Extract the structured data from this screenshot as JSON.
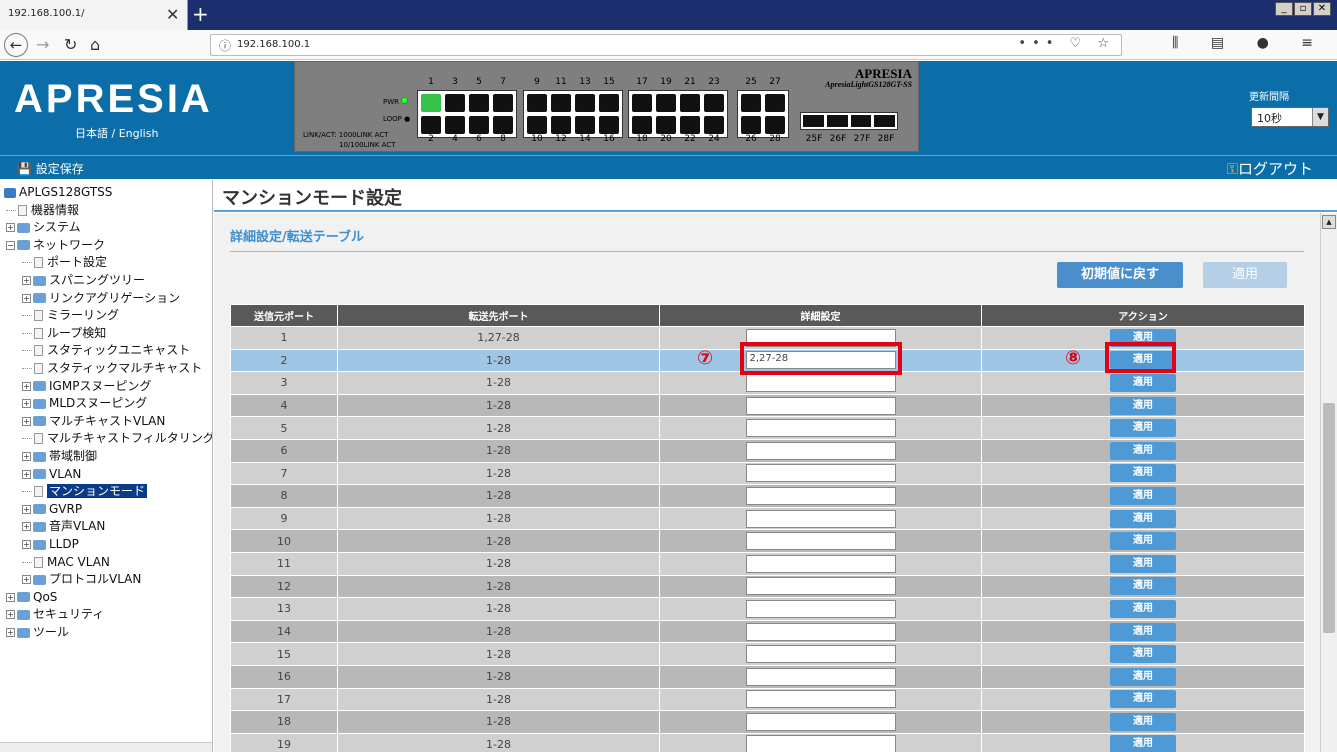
{
  "browser": {
    "tab_title": "192.168.100.1/",
    "tab_close": "✕",
    "new_tab": "+",
    "url": "192.168.100.1",
    "url_actions": "••• ♡ ☆",
    "win_controls": [
      "_",
      "▫",
      "✕"
    ],
    "menu_icons": "⫼ ▤ ● ≡"
  },
  "header": {
    "logo": "APRESIA",
    "language": "日本語 / English",
    "refresh_label": "更新間隔",
    "refresh_value": "10秒",
    "save_label": "設定保存",
    "logout_label": "ログアウト"
  },
  "switch_panel": {
    "brand": "APRESIA",
    "model": "ApresiaLightGS128GT-SS",
    "pwr": "PWR",
    "loop": "LOOP",
    "legend1": "LINK/ACT: 1000LINK   ACT",
    "legend2": "10/100LINK   ACT",
    "top_nums": [
      "1",
      "3",
      "5",
      "7",
      "9",
      "11",
      "13",
      "15",
      "17",
      "19",
      "21",
      "23",
      "25",
      "27"
    ],
    "bottom_nums": [
      "2",
      "4",
      "6",
      "8",
      "10",
      "12",
      "14",
      "16",
      "18",
      "20",
      "22",
      "24",
      "26",
      "28"
    ],
    "sfp_nums": [
      "25F",
      "26F",
      "27F",
      "28F"
    ]
  },
  "sidebar": {
    "items": [
      {
        "label": "APLGS128GTSS",
        "level": 0,
        "type": "root"
      },
      {
        "label": "機器情報",
        "level": 1,
        "type": "page"
      },
      {
        "label": "システム",
        "level": 1,
        "type": "folder"
      },
      {
        "label": "ネットワーク",
        "level": 1,
        "type": "folder-open"
      },
      {
        "label": "ポート設定",
        "level": 2,
        "type": "page"
      },
      {
        "label": "スパニングツリー",
        "level": 2,
        "type": "folder"
      },
      {
        "label": "リンクアグリゲーション",
        "level": 2,
        "type": "folder"
      },
      {
        "label": "ミラーリング",
        "level": 2,
        "type": "page"
      },
      {
        "label": "ループ検知",
        "level": 2,
        "type": "page"
      },
      {
        "label": "スタティックユニキャスト",
        "level": 2,
        "type": "page"
      },
      {
        "label": "スタティックマルチキャスト",
        "level": 2,
        "type": "page"
      },
      {
        "label": "IGMPスヌーピング",
        "level": 2,
        "type": "folder"
      },
      {
        "label": "MLDスヌーピング",
        "level": 2,
        "type": "folder"
      },
      {
        "label": "マルチキャストVLAN",
        "level": 2,
        "type": "folder"
      },
      {
        "label": "マルチキャストフィルタリング",
        "level": 2,
        "type": "page"
      },
      {
        "label": "帯域制御",
        "level": 2,
        "type": "folder"
      },
      {
        "label": "VLAN",
        "level": 2,
        "type": "folder"
      },
      {
        "label": "マンションモード",
        "level": 2,
        "type": "page",
        "selected": true
      },
      {
        "label": "GVRP",
        "level": 2,
        "type": "folder"
      },
      {
        "label": "音声VLAN",
        "level": 2,
        "type": "folder"
      },
      {
        "label": "LLDP",
        "level": 2,
        "type": "folder"
      },
      {
        "label": "MAC VLAN",
        "level": 2,
        "type": "page"
      },
      {
        "label": "プロトコルVLAN",
        "level": 2,
        "type": "folder"
      },
      {
        "label": "QoS",
        "level": 1,
        "type": "folder"
      },
      {
        "label": "セキュリティ",
        "level": 1,
        "type": "folder"
      },
      {
        "label": "ツール",
        "level": 1,
        "type": "folder"
      }
    ]
  },
  "main": {
    "page_title": "マンションモード設定",
    "section_title": "詳細設定/転送テーブル",
    "reset_button": "初期値に戻す",
    "apply_button": "適用",
    "table": {
      "headers": [
        "送信元ポート",
        "転送先ポート",
        "詳細設定",
        "アクション"
      ],
      "action_label": "適用",
      "rows": [
        {
          "src": "1",
          "dst": "1,27-28",
          "detail": ""
        },
        {
          "src": "2",
          "dst": "1-28",
          "detail": "2,27-28",
          "highlight": true
        },
        {
          "src": "3",
          "dst": "1-28",
          "detail": ""
        },
        {
          "src": "4",
          "dst": "1-28",
          "detail": ""
        },
        {
          "src": "5",
          "dst": "1-28",
          "detail": ""
        },
        {
          "src": "6",
          "dst": "1-28",
          "detail": ""
        },
        {
          "src": "7",
          "dst": "1-28",
          "detail": ""
        },
        {
          "src": "8",
          "dst": "1-28",
          "detail": ""
        },
        {
          "src": "9",
          "dst": "1-28",
          "detail": ""
        },
        {
          "src": "10",
          "dst": "1-28",
          "detail": ""
        },
        {
          "src": "11",
          "dst": "1-28",
          "detail": ""
        },
        {
          "src": "12",
          "dst": "1-28",
          "detail": ""
        },
        {
          "src": "13",
          "dst": "1-28",
          "detail": ""
        },
        {
          "src": "14",
          "dst": "1-28",
          "detail": ""
        },
        {
          "src": "15",
          "dst": "1-28",
          "detail": ""
        },
        {
          "src": "16",
          "dst": "1-28",
          "detail": ""
        },
        {
          "src": "17",
          "dst": "1-28",
          "detail": ""
        },
        {
          "src": "18",
          "dst": "1-28",
          "detail": ""
        },
        {
          "src": "19",
          "dst": "1-28",
          "detail": ""
        }
      ]
    },
    "annotations": [
      "⑦",
      "⑧"
    ]
  },
  "colors": {
    "accent": "#0b6ea8",
    "highlight": "#e50012",
    "button": "#4d9ad6"
  }
}
